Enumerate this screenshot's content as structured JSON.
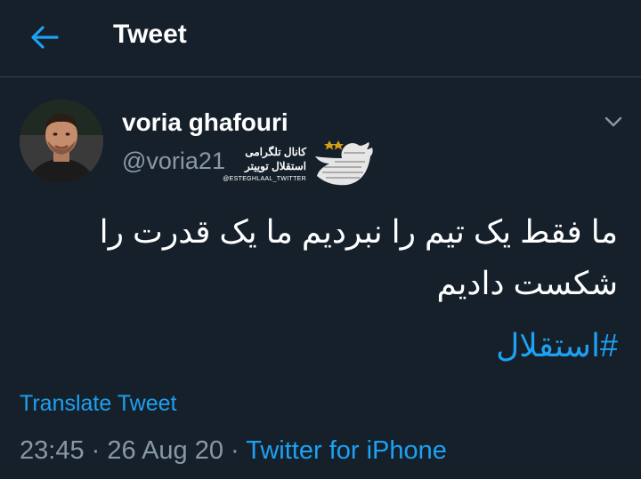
{
  "header": {
    "title": "Tweet",
    "back_icon": "arrow-left-icon"
  },
  "author": {
    "name": "voria ghafouri",
    "handle": "@voria21",
    "avatar_icon": "avatar-photo"
  },
  "watermark": {
    "line1": "کانال تلگرامی",
    "line2": "استقلال توییتر",
    "line3": "@ESTEGHLAAL_TWITTER"
  },
  "tweet": {
    "line1": "ما فقط یک تیم را نبردیم ما یک قدرت را",
    "line2": "شکست دادیم",
    "hashtag": "#استقلال"
  },
  "translate_label": "Translate Tweet",
  "meta": {
    "time": "23:45",
    "sep1": " · ",
    "date": "26 Aug 20",
    "sep2": " · ",
    "source": "Twitter for iPhone"
  },
  "colors": {
    "background": "#15202b",
    "accent": "#1da1f2",
    "muted": "#8899a6"
  }
}
